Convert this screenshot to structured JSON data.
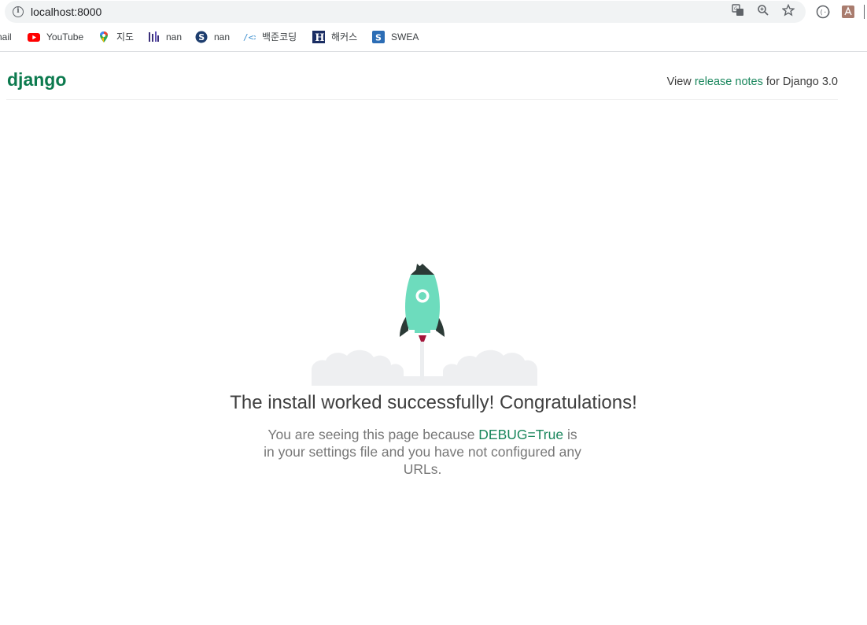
{
  "browser": {
    "url": "localhost:8000",
    "bookmarks": [
      {
        "label": "nail",
        "icon": "gmail-icon"
      },
      {
        "label": "YouTube",
        "icon": "youtube-icon"
      },
      {
        "label": "지도",
        "icon": "maps-icon"
      },
      {
        "label": "nan",
        "icon": "bookmark-icon"
      },
      {
        "label": "nan",
        "icon": "s-circle-icon"
      },
      {
        "label": "백준코딩",
        "icon": "code-icon"
      },
      {
        "label": "해커스",
        "icon": "h-icon"
      },
      {
        "label": "SWEA",
        "icon": "s-square-icon"
      }
    ]
  },
  "page": {
    "logo": "django",
    "release_prefix": "View",
    "release_link": "release notes",
    "release_suffix": "for Django 3.0",
    "headline": "The install worked successfully! Congratulations!",
    "sub_prefix": "You are seeing this page because",
    "sub_debug": "DEBUG=True",
    "sub_suffix": "is in your settings file and you have not configured any URLs."
  },
  "colors": {
    "brand": "#0c7a4e",
    "link": "#19865c",
    "rocket_body": "#6ddcbd",
    "rocket_dark": "#2b3a36",
    "cloud": "#f1f2f4"
  }
}
